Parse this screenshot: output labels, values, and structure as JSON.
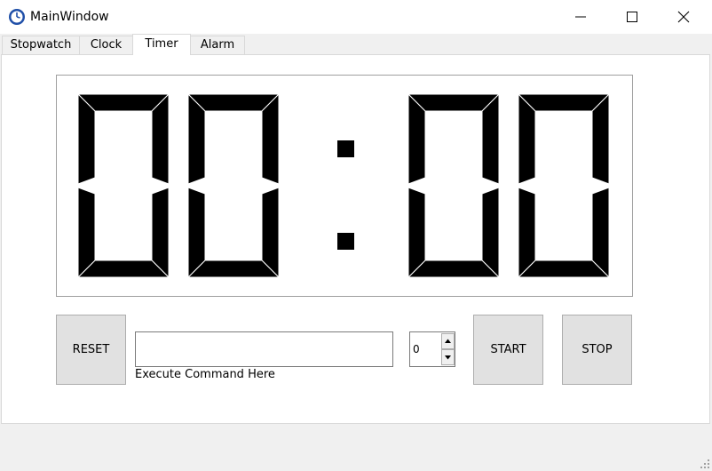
{
  "window": {
    "title": "MainWindow",
    "controls": {
      "minimize_icon": "minimize-icon",
      "maximize_icon": "maximize-icon",
      "close_icon": "close-icon"
    }
  },
  "tabs": [
    {
      "label": "Stopwatch",
      "active": false
    },
    {
      "label": "Clock",
      "active": false
    },
    {
      "label": "Timer",
      "active": true
    },
    {
      "label": "Alarm",
      "active": false
    }
  ],
  "timer": {
    "display": "00:00",
    "display_color": "#000000"
  },
  "controls": {
    "reset_label": "RESET",
    "command_value": "",
    "command_hint": "Execute Command Here",
    "spin_value": "0",
    "start_label": "START",
    "stop_label": "STOP"
  }
}
